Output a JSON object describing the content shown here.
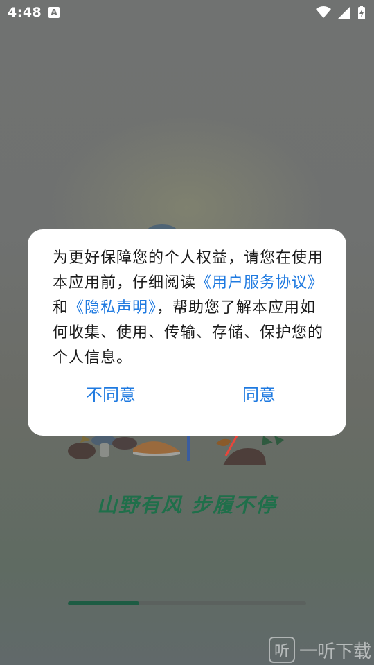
{
  "status_bar": {
    "time": "4:48",
    "notification_badge": "A",
    "icons": [
      "wifi-icon",
      "signal-icon",
      "battery-charging-icon"
    ]
  },
  "dialog": {
    "text_1": "为更好保障您的个人权益，请您在使用本应用前，仔细阅读",
    "link_terms": "《用户服务协议》",
    "text_2": "和",
    "link_privacy": "《隐私声明》",
    "text_3": "，帮助您了解本应用如何收集、使用、传输、存储、保护您的个人信息。",
    "disagree_label": "不同意",
    "agree_label": "同意"
  },
  "splash": {
    "slogan": "山野有风  步履不停",
    "progress": 0.3
  },
  "watermark": {
    "logo_char": "听",
    "text": "一听下载"
  },
  "colors": {
    "link": "#1f7ae0",
    "slogan": "#1f6f4a",
    "annotation_arrow": "#e8463b"
  }
}
